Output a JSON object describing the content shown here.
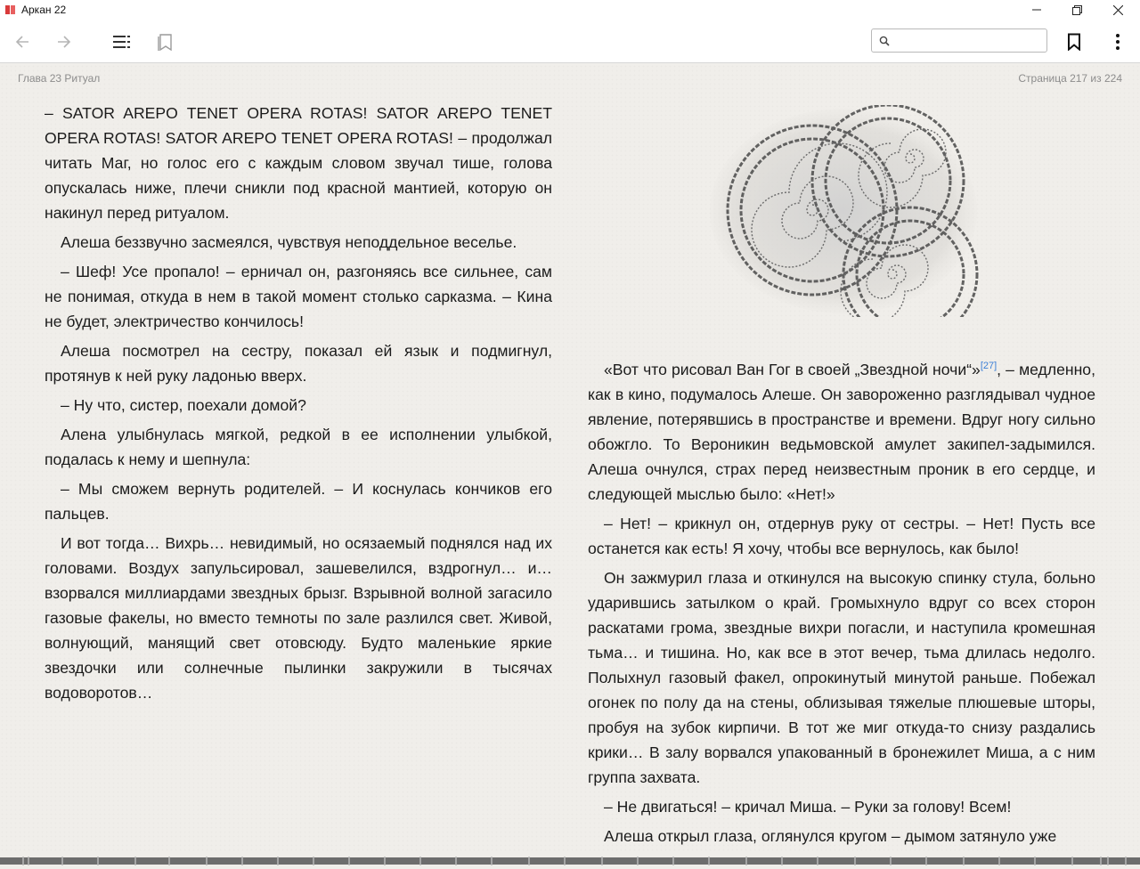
{
  "window": {
    "title": "Аркан 22"
  },
  "toolbar": {
    "back_icon": "arrow-left-icon",
    "forward_icon": "arrow-right-icon",
    "toc_icon": "table-of-contents-icon",
    "bookmarks_icon": "bookmarks-list-icon",
    "search_placeholder": "",
    "bookmark_icon": "bookmark-icon",
    "more_icon": "more-vertical-icon"
  },
  "header": {
    "chapter": "Глава 23 Ритуал",
    "page": "Страница 217 из 224"
  },
  "left_column": {
    "paragraphs": [
      "– SATOR AREPO TENET OPERA ROTAS! SATOR AREPO TENET OPERA ROTAS! SATOR AREPO TENET OPERA ROTAS! – продолжал читать Маг, но голос его с каждым словом звучал тише, голова опускалась ниже, плечи сникли под красной мантией, которую он накинул перед ритуалом.",
      "Алеша беззвучно засмеялся, чувствуя неподдельное веселье.",
      "– Шеф! Усе пропало! – ерничал он, разгоняясь все сильнее, сам не понимая, откуда в нем в такой момент столько сарказма. – Кина не будет, электричество кончилось!",
      "Алеша посмотрел на сестру, показал ей язык и подмигнул, протянув к ней руку ладонью вверх.",
      "– Ну что, систер, поехали домой?",
      "Алена улыбнулась мягкой, редкой в ее исполнении улыбкой, подалась к нему и шепнула:",
      "– Мы сможем вернуть родителей. – И коснулась кончиков его пальцев.",
      "И вот тогда… Вихрь… невидимый, но осязаемый поднялся над их головами. Воздух запульсировал, зашевелился, вздрогнул… и… взорвался миллиардами звездных брызг. Взрывной волной загасило газовые факелы, но вместо темноты по зале разлился свет. Живой, волнующий, манящий свет отовсюду. Будто маленькие яркие звездочки или солнечные пылинки закружили в тысячах водоворотов…"
    ]
  },
  "right_column": {
    "p1_before": "«Вот что рисовал Ван Гог в своей „Звездной ночи“»",
    "p1_footnote": "[27]",
    "p1_after": ", – медленно, как в кино, подумалось Алеше. Он завороженно разглядывал чудное явление, потерявшись в пространстве и времени. Вдруг ногу сильно обожгло. То Вероникин ведьмовской амулет закипел-задымился. Алеша очнулся, страх перед неизвестным проник в его сердце, и следующей мыслью было: «Нет!»",
    "paragraphs": [
      "– Нет! – крикнул он, отдернув руку от сестры. – Нет! Пусть все останется как есть! Я хочу, чтобы все вернулось, как было!",
      "Он зажмурил глаза и откинулся на высокую спинку стула, больно ударившись затылком о край. Громыхнуло вдруг со всех сторон раскатами грома, звездные вихри погасли, и наступила кромешная тьма… и тишина. Но, как все в этот вечер, тьма длилась недолго. Полыхнул газовый факел, опрокинутый минутой раньше. Побежал огонек по полу да на стены, облизывая тяжелые плюшевые шторы, пробуя на зубок кирпичи. В тот же миг откуда-то снизу раздались крики… В залу ворвался упакованный в бронежилет Миша, а с ним группа захвата.",
      "– Не двигаться! – кричал Миша. – Руки за голову! Всем!",
      "Алеша открыл глаза, оглянулся кругом – дымом затянуло уже"
    ]
  },
  "illustration": {
    "icon": "swirl-illustration"
  },
  "progress": {
    "fraction": 0.97
  }
}
